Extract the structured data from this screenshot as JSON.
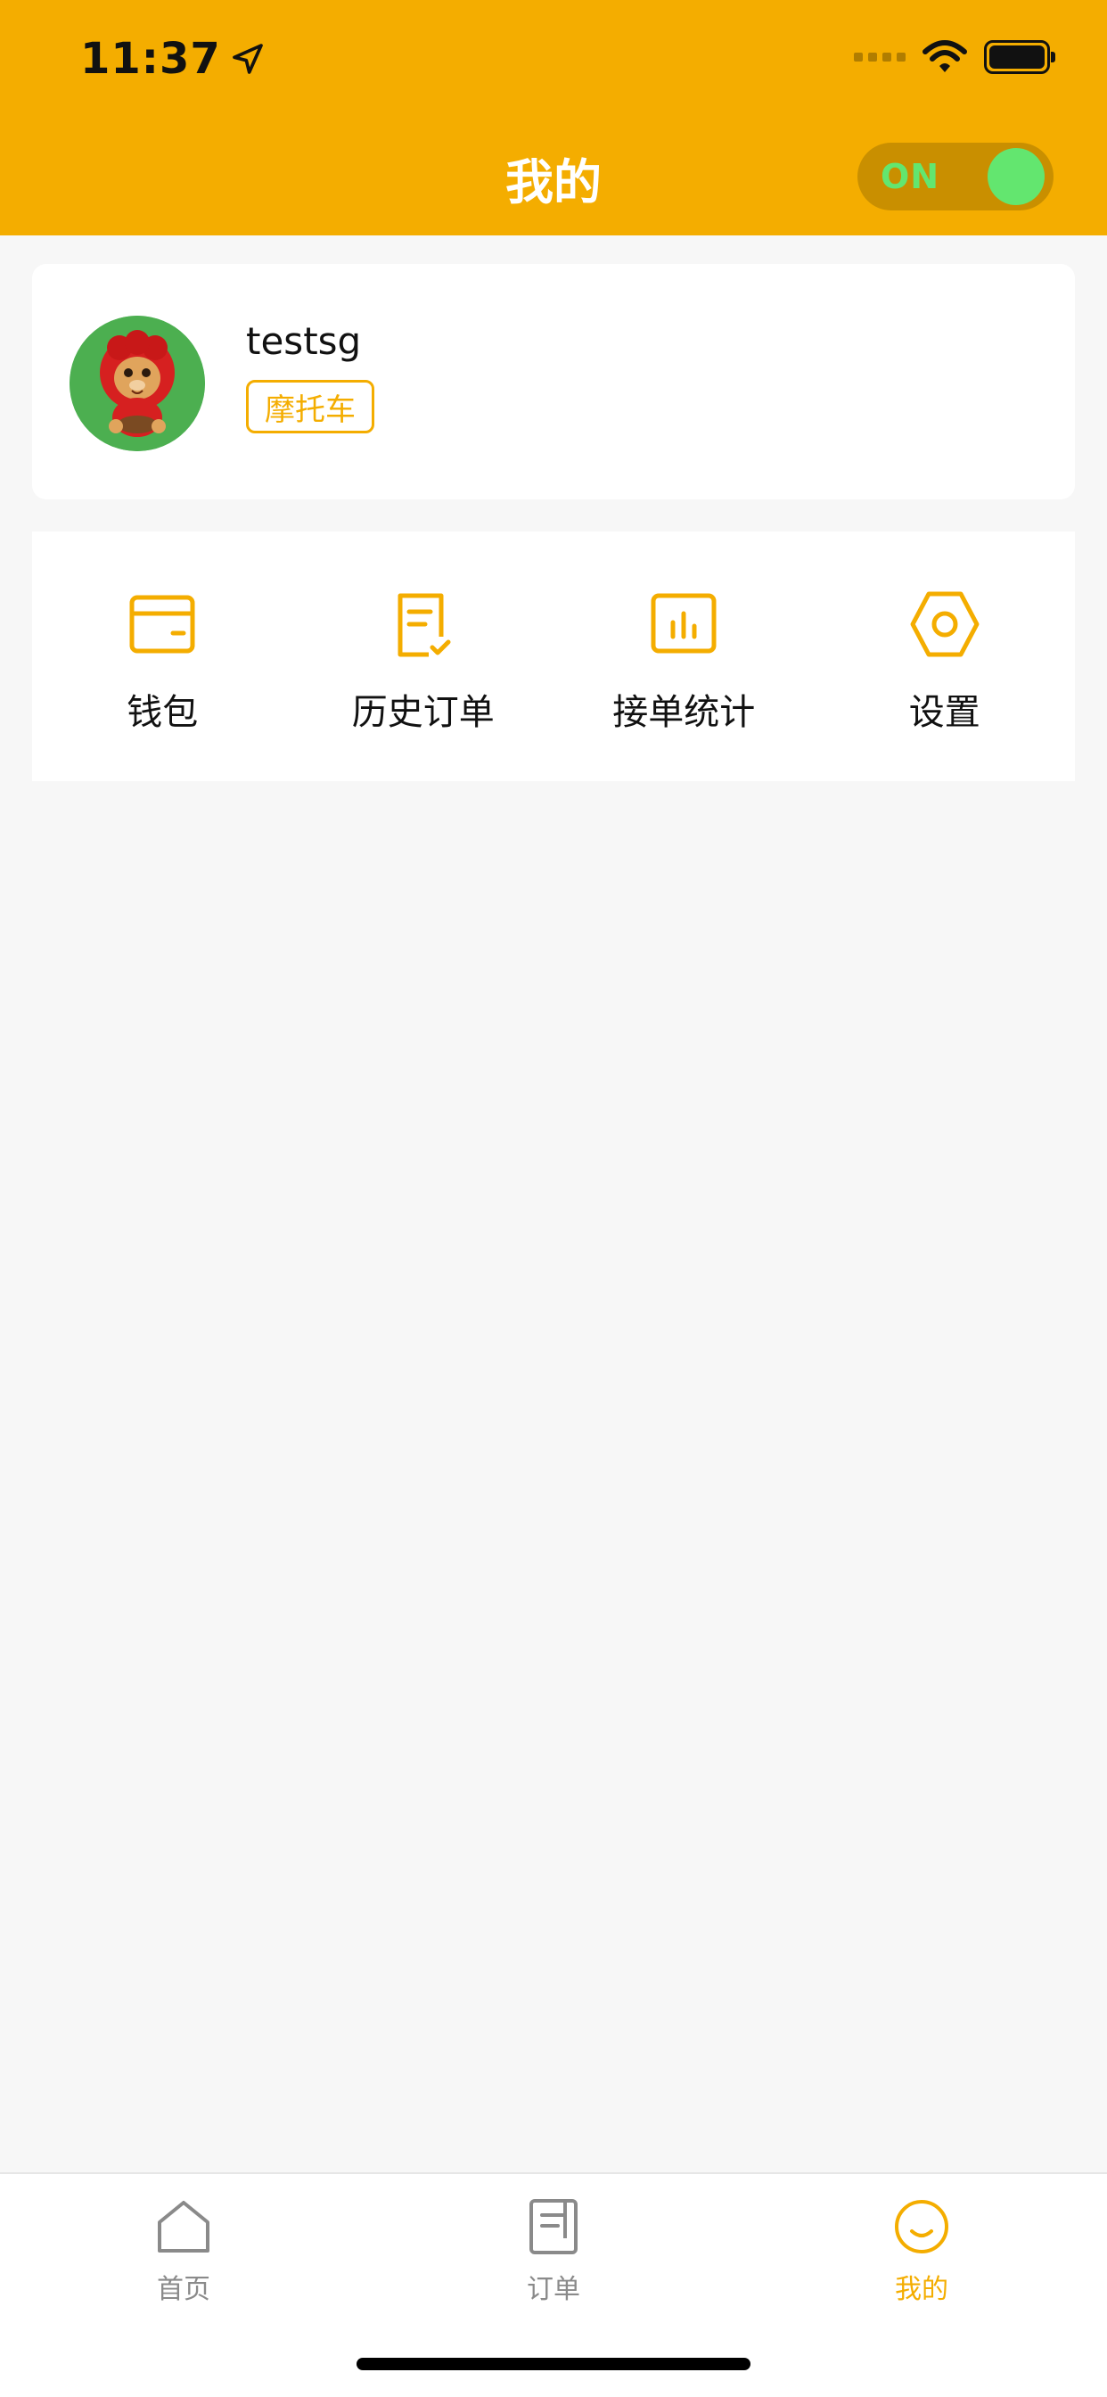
{
  "status_bar": {
    "time": "11:37",
    "location_icon": "location-arrow-icon",
    "signal_icon": "cellular-dots-icon",
    "wifi_icon": "wifi-icon",
    "battery_icon": "battery-icon"
  },
  "nav": {
    "title": "我的",
    "toggle_label": "ON",
    "toggle_on": true
  },
  "profile": {
    "username": "testsg",
    "vehicle_tag": "摩托车",
    "avatar_icon": "lion-mascot-avatar"
  },
  "menu": {
    "items": [
      {
        "label": "钱包",
        "icon": "wallet-icon"
      },
      {
        "label": "历史订单",
        "icon": "history-order-icon"
      },
      {
        "label": "接单统计",
        "icon": "statistics-icon"
      },
      {
        "label": "设置",
        "icon": "settings-icon"
      }
    ]
  },
  "tabbar": {
    "tabs": [
      {
        "label": "首页",
        "icon": "home-icon",
        "active": false
      },
      {
        "label": "订单",
        "icon": "orders-icon",
        "active": false
      },
      {
        "label": "我的",
        "icon": "profile-smile-icon",
        "active": true
      }
    ]
  },
  "colors": {
    "brand": "#f4ad00",
    "toggle_green": "#63e66f",
    "background": "#f7f7f7",
    "inactive_tab": "#8a8a8a"
  }
}
